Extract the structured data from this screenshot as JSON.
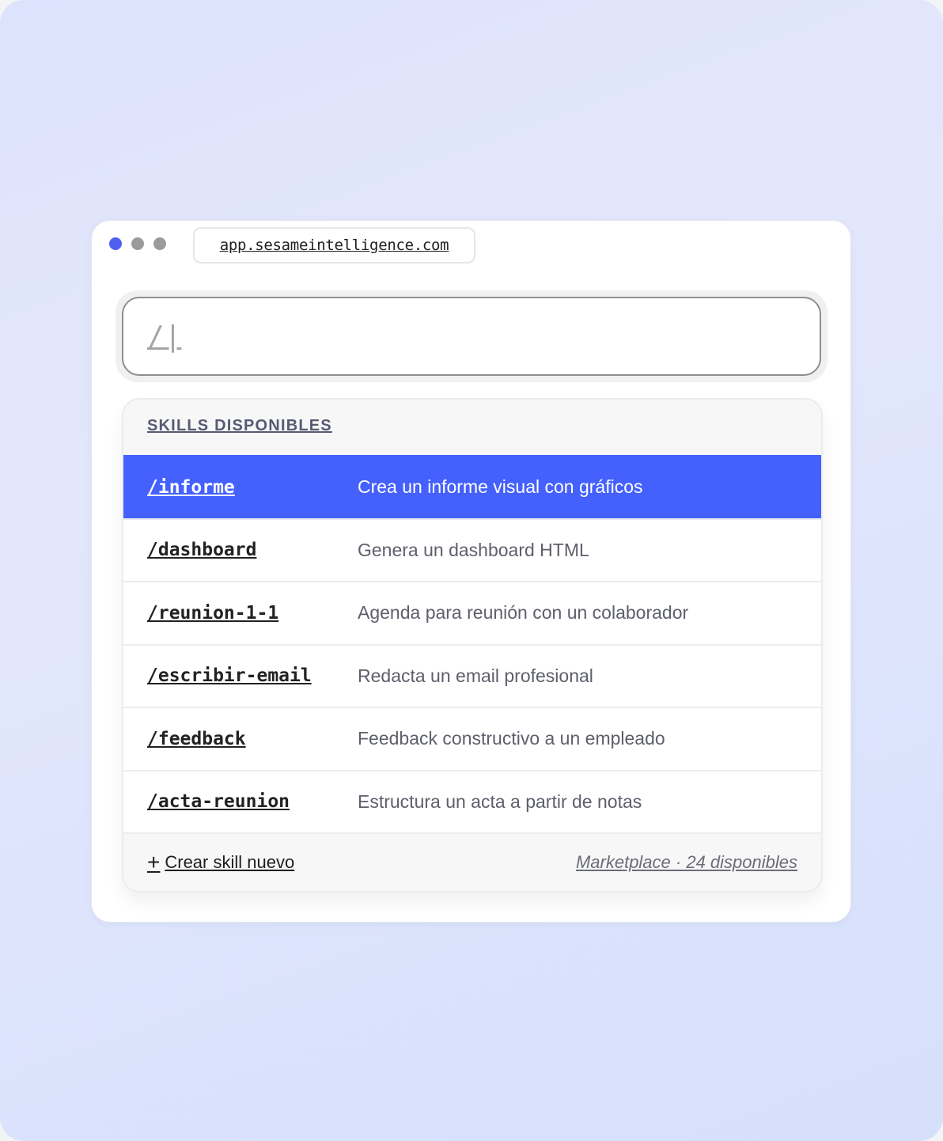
{
  "window": {
    "url": "app.sesameintelligence.com",
    "dot_colors": [
      "#4f5ff0",
      "#9b9b9b",
      "#9b9b9b"
    ]
  },
  "search": {
    "value": "/|"
  },
  "panel": {
    "header": "SKILLS DISPONIBLES",
    "selected_index": 0,
    "items": [
      {
        "command": "/informe",
        "description": "Crea un informe visual con gráficos"
      },
      {
        "command": "/dashboard",
        "description": "Genera un dashboard HTML"
      },
      {
        "command": "/reunion-1-1",
        "description": "Agenda para reunión con un colaborador"
      },
      {
        "command": "/escribir-email",
        "description": "Redacta un email profesional"
      },
      {
        "command": "/feedback",
        "description": "Feedback constructivo a un empleado"
      },
      {
        "command": "/acta-reunion",
        "description": "Estructura un acta a partir de notas"
      }
    ],
    "footer": {
      "create_icon": "plus-icon",
      "create_label": "Crear skill nuevo",
      "marketplace": "Marketplace · 24 disponibles"
    }
  },
  "colors": {
    "accent": "#4460fd",
    "active_dot": "#4f5ff0",
    "inactive_dot": "#9b9b9b"
  }
}
